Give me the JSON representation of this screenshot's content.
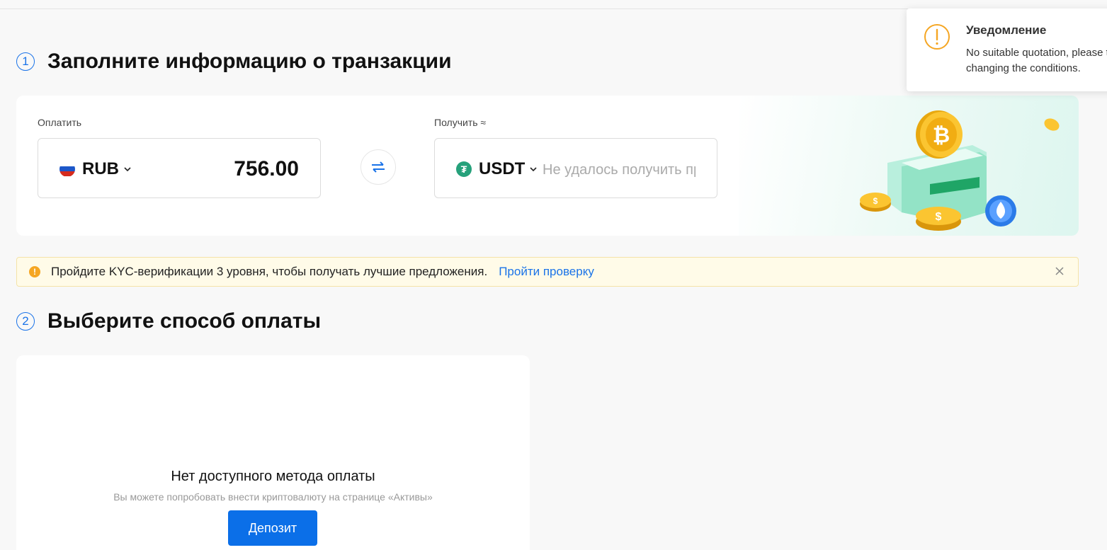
{
  "step1": {
    "number": "1",
    "title": "Заполните информацию о транзакции"
  },
  "pay": {
    "label": "Оплатить",
    "currency": "RUB",
    "amount": "756.00"
  },
  "receive": {
    "label": "Получить ≈",
    "currency": "USDT",
    "placeholder": "Не удалось получить пр",
    "icon_symbol": "₮"
  },
  "kyc": {
    "icon_symbol": "!",
    "text": "Пройдите KYC-верификации 3 уровня, чтобы получать лучшие предложения.",
    "link": "Пройти проверку"
  },
  "step2": {
    "number": "2",
    "title": "Выберите способ оплаты"
  },
  "payment_methods": {
    "empty_title": "Нет доступного метода оплаты",
    "empty_subtitle": "Вы можете попробовать внести криптовалюту на странице «Активы»",
    "deposit_label": "Депозит"
  },
  "notification": {
    "title": "Уведомление",
    "message": "No suitable quotation, please try changing the conditions."
  },
  "icons": {
    "swap": "swap-arrows-icon",
    "chevron": "chevron-down-icon",
    "close": "close-icon",
    "warning": "warning-circle-icon"
  },
  "colors": {
    "accent": "#1a73e8",
    "primary_button": "#0b6fe8",
    "tether": "#26a17b",
    "warning": "#f5a623",
    "banner_bg": "#fffbe8"
  }
}
